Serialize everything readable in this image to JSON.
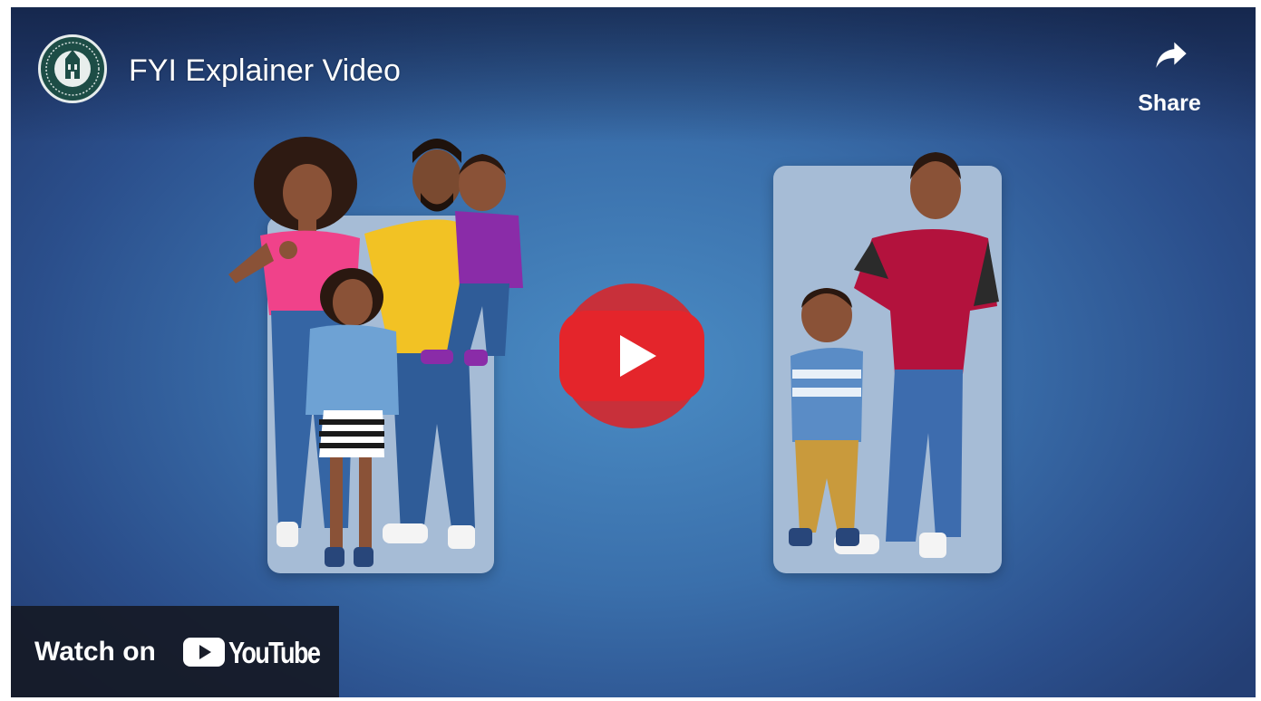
{
  "video": {
    "title": "FYI Explainer Video"
  },
  "channel": {
    "avatar_icon": "seal-logo-icon"
  },
  "share": {
    "label": "Share",
    "icon": "share-arrow-icon"
  },
  "play": {
    "icon": "play-icon",
    "color": "#e4252b"
  },
  "watch_on": {
    "label": "Watch on",
    "logo_text": "YouTube",
    "logo_icon": "youtube-logo-icon"
  },
  "colors": {
    "background_center": "#4a8cc4",
    "background_edge": "#243f75",
    "card": "#a6bcd6",
    "play_red": "#e4252b",
    "avatar_green": "#1d4d46"
  }
}
